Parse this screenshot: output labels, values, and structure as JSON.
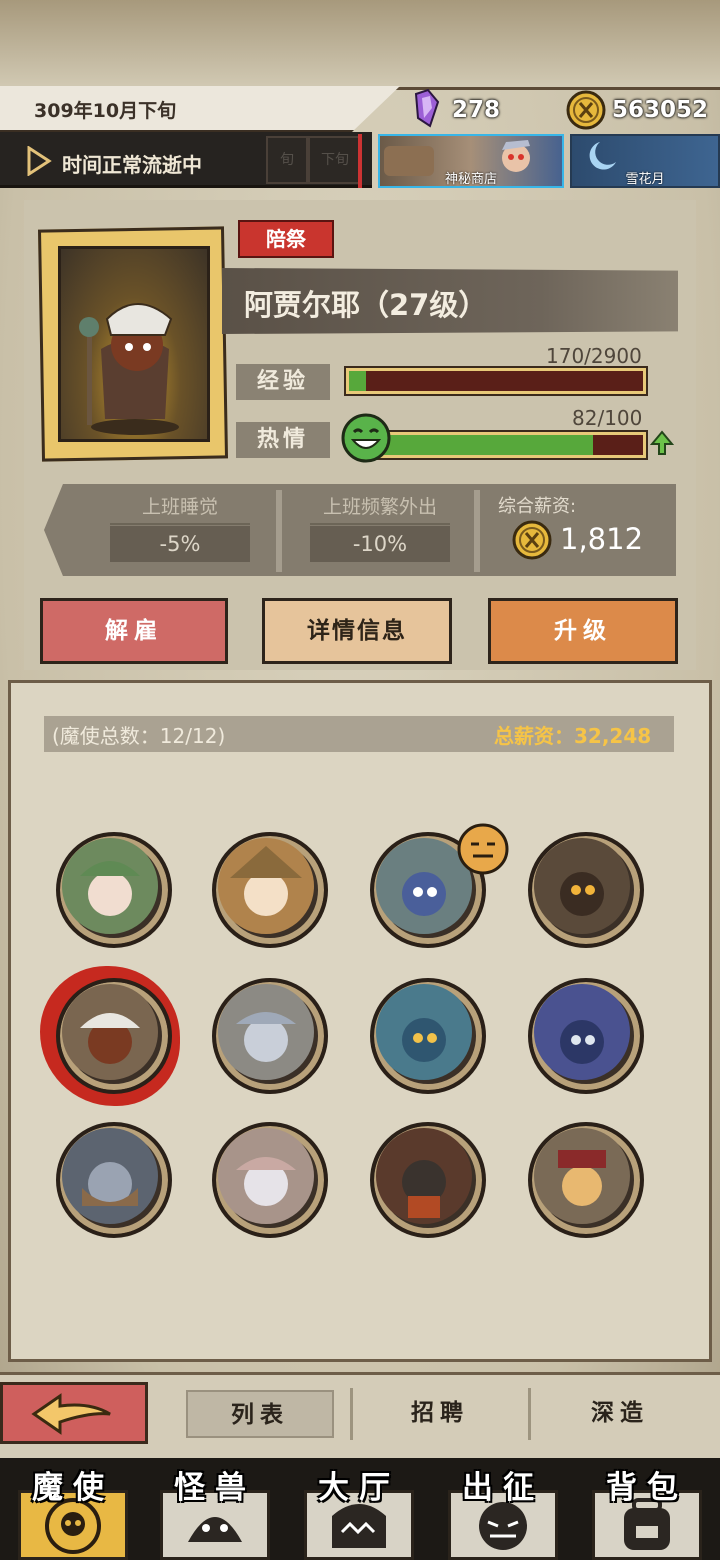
{
  "top_bar": {
    "date": "309年10月下旬",
    "crystals": "278",
    "coins": "563052",
    "time_status": "时间正常流逝中",
    "mini_tabs": [
      "旬",
      "下旬"
    ],
    "shop_label": "神秘商店",
    "event_label": "雪花月"
  },
  "hero": {
    "role_badge": "陪祭",
    "name": "阿贾尔耶（27级）",
    "exp_label": "经验",
    "exp_value": "170/2900",
    "exp_fraction": 0.059,
    "passion_label": "热情",
    "passion_value": "82/100",
    "passion_fraction": 0.82,
    "effects": [
      {
        "name": "上班睡觉",
        "value": "-5%"
      },
      {
        "name": "上班频繁外出",
        "value": "-10%"
      }
    ],
    "salary_label": "综合薪资:",
    "salary_value": "1,812"
  },
  "actions": {
    "fire": "解雇",
    "detail": "详情信息",
    "upgrade": "升级"
  },
  "roster": {
    "count_label": "(魔使总数：12/12)",
    "total_salary": "总薪资：32,248"
  },
  "sub_tabs": {
    "list": "列表",
    "recruit": "招聘",
    "deep": "深造"
  },
  "nav": [
    {
      "label": "魔使",
      "icon": "skull-emblem-icon",
      "active": true
    },
    {
      "label": "怪兽",
      "icon": "monster-face-icon",
      "active": false
    },
    {
      "label": "大厅",
      "icon": "hall-shark-icon",
      "active": false
    },
    {
      "label": "出征",
      "icon": "expedition-mask-icon",
      "active": false
    },
    {
      "label": "背包",
      "icon": "backpack-icon",
      "active": false
    }
  ],
  "colors": {
    "accent_red": "#c9352e",
    "exp_green": "#57a83b",
    "gold": "#f6c447",
    "shop_border": "#38b6e8"
  }
}
